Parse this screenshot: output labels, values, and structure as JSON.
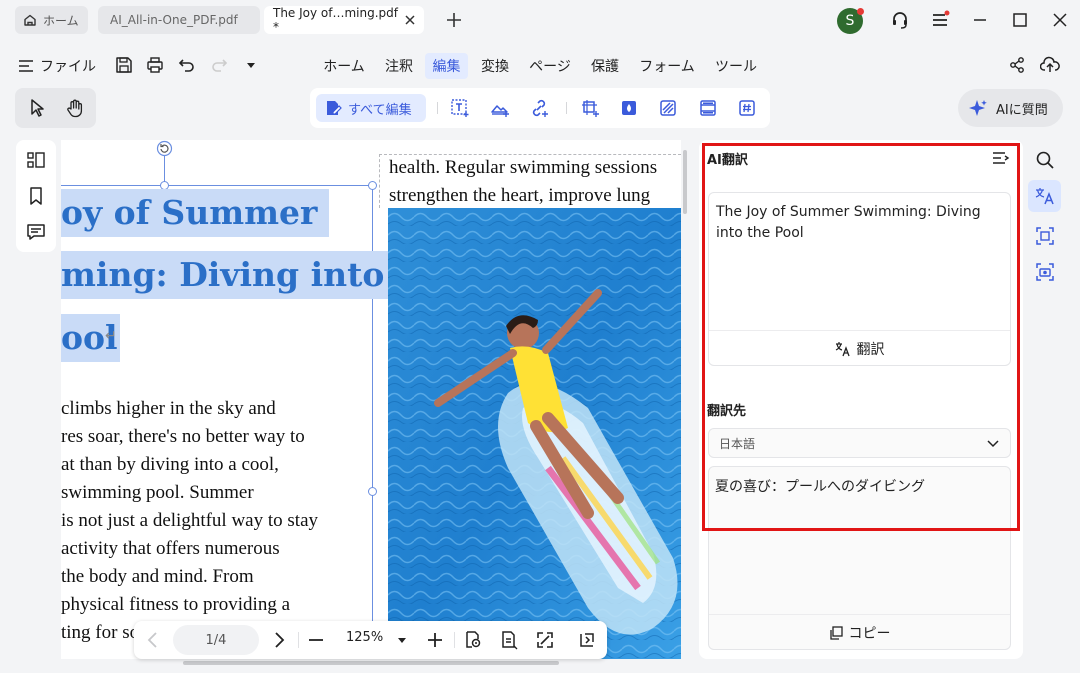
{
  "tabs": {
    "home_label": "ホーム",
    "file1": "AI_All-in-One_PDF.pdf",
    "file2": "The Joy of…ming.pdf *"
  },
  "titlebar": {
    "avatar_letter": "S"
  },
  "menubar": {
    "file_label": "ファイル",
    "tabs": [
      "ホーム",
      "注釈",
      "編集",
      "変換",
      "ページ",
      "保護",
      "フォーム",
      "ツール"
    ],
    "active_tab": "編集"
  },
  "toolbar": {
    "edit_all_label": "すべて編集",
    "ai_ask_label": "AIに質問"
  },
  "document": {
    "title_lines": [
      "oy of Summer",
      "ming: Diving into",
      "ool"
    ],
    "body_lines": [
      "climbs higher in the sky and",
      "res soar, there's no better way to",
      "at than by diving into a cool,",
      "swimming pool. Summer",
      "is not just a delightful way to stay",
      " activity that offers numerous",
      " the body and mind. From",
      "physical fitness to providing a",
      "ting for so"
    ],
    "right_lines": [
      "health. Regular swimming sessions",
      "strengthen the heart, improve lung"
    ]
  },
  "bottombar": {
    "page_indicator": "1/4",
    "zoom": "125%"
  },
  "ai_panel": {
    "title": "AI翻訳",
    "source_text": "The Joy of Summer  Swimming: Diving into the Pool",
    "translate_label": "翻訳",
    "target_label": "翻訳先",
    "target_language": "日本語",
    "result_text": "夏の喜び：プールへのダイビング",
    "copy_label": "コピー"
  },
  "colors": {
    "accent": "#3b5bdb",
    "highlight_border": "#e11515",
    "title_text": "#2b6fc7",
    "title_bg": "#c9dbf7",
    "avatar_bg": "#2f6b2f"
  }
}
